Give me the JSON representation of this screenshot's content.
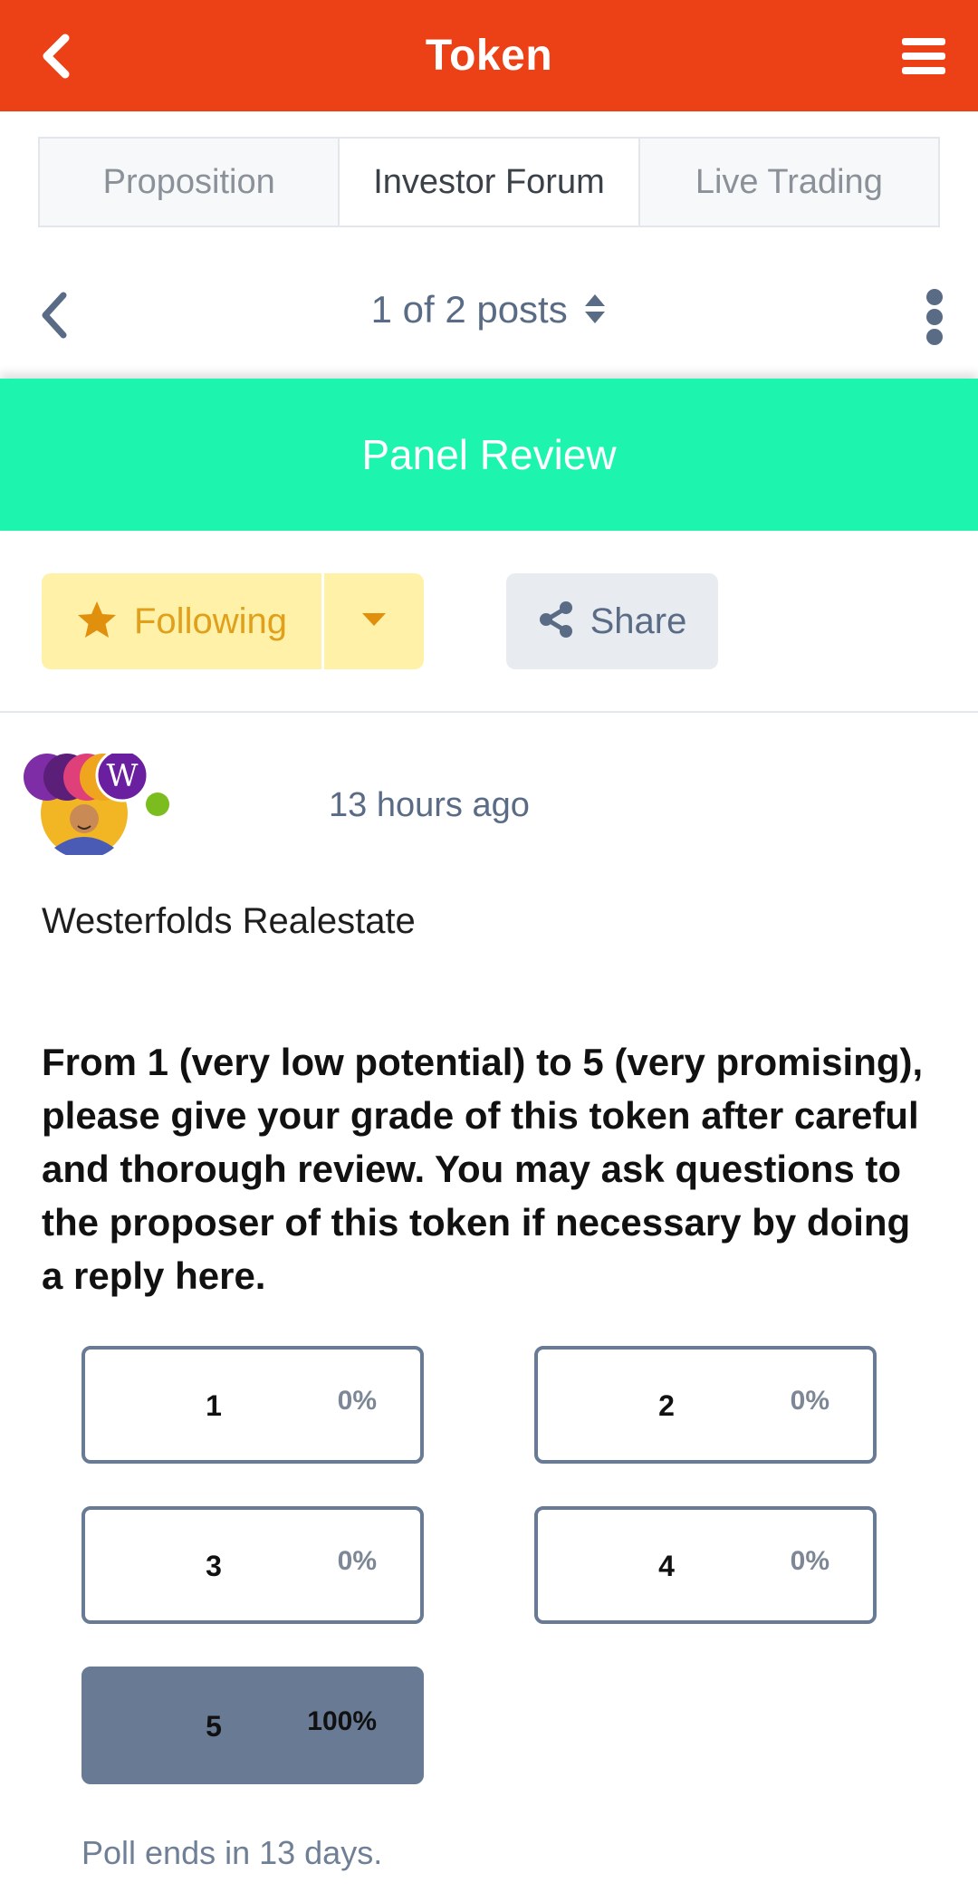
{
  "appbar": {
    "title": "Token",
    "back_icon": "chevron-left-icon",
    "menu_icon": "hamburger-menu-icon",
    "color": "#ec4117"
  },
  "tabs": [
    {
      "label": "Proposition",
      "active": false
    },
    {
      "label": "Investor Forum",
      "active": true
    },
    {
      "label": "Live Trading",
      "active": false
    }
  ],
  "post_nav": {
    "label": "1 of 2 posts",
    "current": 1,
    "total": 2
  },
  "banner": {
    "title": "Panel Review",
    "color": "#1df5ae"
  },
  "actions": {
    "following_label": "Following",
    "share_label": "Share"
  },
  "post": {
    "timestamp": "13 hours ago",
    "author": "Westerfolds Realestate",
    "question": "From 1 (very low potential) to 5 (very promising), please give your grade of this token after careful and thorough review. You may ask questions to the proposer of this token if necessary by doing a reply here.",
    "online": true
  },
  "poll": {
    "options": [
      {
        "label": "1",
        "percent": "0%",
        "selected": false
      },
      {
        "label": "2",
        "percent": "0%",
        "selected": false
      },
      {
        "label": "3",
        "percent": "0%",
        "selected": false
      },
      {
        "label": "4",
        "percent": "0%",
        "selected": false
      },
      {
        "label": "5",
        "percent": "100%",
        "selected": true
      }
    ],
    "footer": "Poll ends in 13 days.",
    "accent": "#687a94"
  }
}
